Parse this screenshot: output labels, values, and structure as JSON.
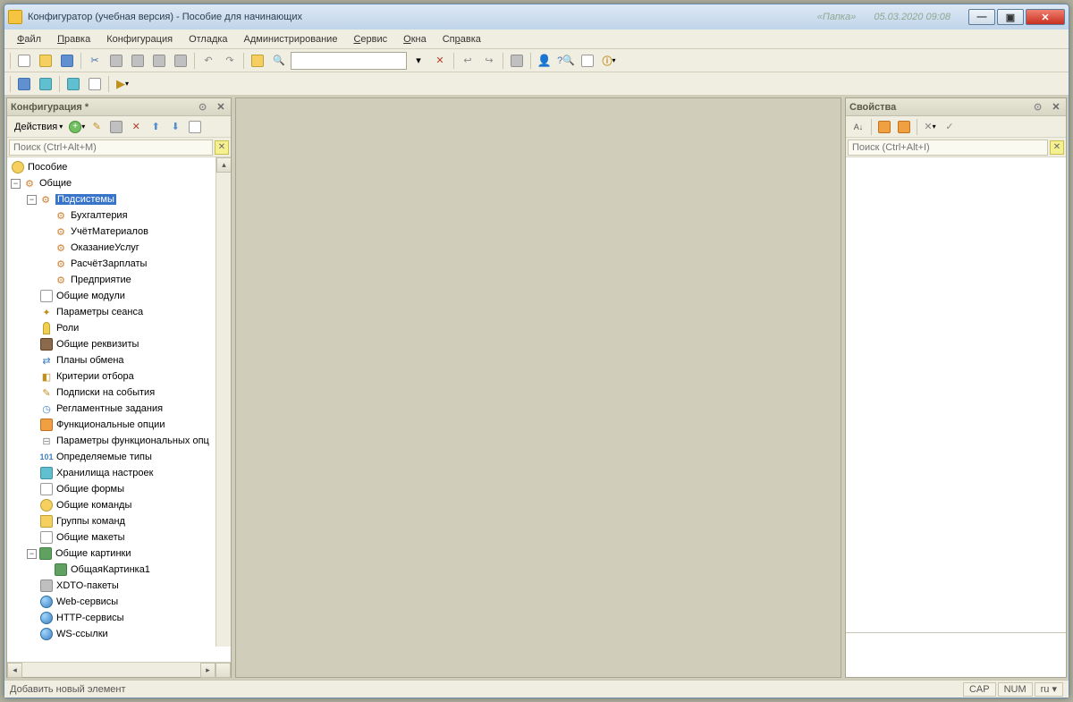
{
  "window": {
    "title": "Конфигуратор (учебная версия) - Пособие для начинающих",
    "faded_hint": "«Папка»",
    "faded_date": "05.03.2020 09:08"
  },
  "menu": {
    "file": "Файл",
    "edit": "Правка",
    "config": "Конфигурация",
    "debug": "Отладка",
    "admin": "Администрирование",
    "service": "Сервис",
    "windows": "Окна",
    "help": "Справка"
  },
  "config_panel": {
    "title": "Конфигурация *",
    "actions_label": "Действия",
    "search_placeholder": "Поиск (Ctrl+Alt+M)"
  },
  "props_panel": {
    "title": "Свойства",
    "search_placeholder": "Поиск (Ctrl+Alt+I)"
  },
  "tree": {
    "root": "Пособие",
    "common": "Общие",
    "subsystems": "Подсистемы",
    "sub_items": {
      "accounting": "Бухгалтерия",
      "materials": "УчётМатериалов",
      "services": "ОказаниеУслуг",
      "salary": "РасчётЗарплаты",
      "enterprise": "Предприятие"
    },
    "common_items": {
      "modules": "Общие модули",
      "session_params": "Параметры сеанса",
      "roles": "Роли",
      "common_attrs": "Общие реквизиты",
      "exchange_plans": "Планы обмена",
      "filter_criteria": "Критерии отбора",
      "event_subs": "Подписки на события",
      "scheduled_jobs": "Регламентные задания",
      "func_options": "Функциональные опции",
      "func_opt_params": "Параметры функциональных опц",
      "defined_types": "Определяемые типы",
      "settings_storages": "Хранилища настроек",
      "common_forms": "Общие формы",
      "common_commands": "Общие команды",
      "command_groups": "Группы команд",
      "common_templates": "Общие макеты",
      "common_pictures": "Общие картинки",
      "picture1": "ОбщаяКартинка1",
      "xdto": "XDTO-пакеты",
      "web_services": "Web-сервисы",
      "http_services": "HTTP-сервисы",
      "ws_refs": "WS-ссылки"
    }
  },
  "statusbar": {
    "hint": "Добавить новый элемент",
    "cap": "CAP",
    "num": "NUM",
    "lang": "ru"
  }
}
